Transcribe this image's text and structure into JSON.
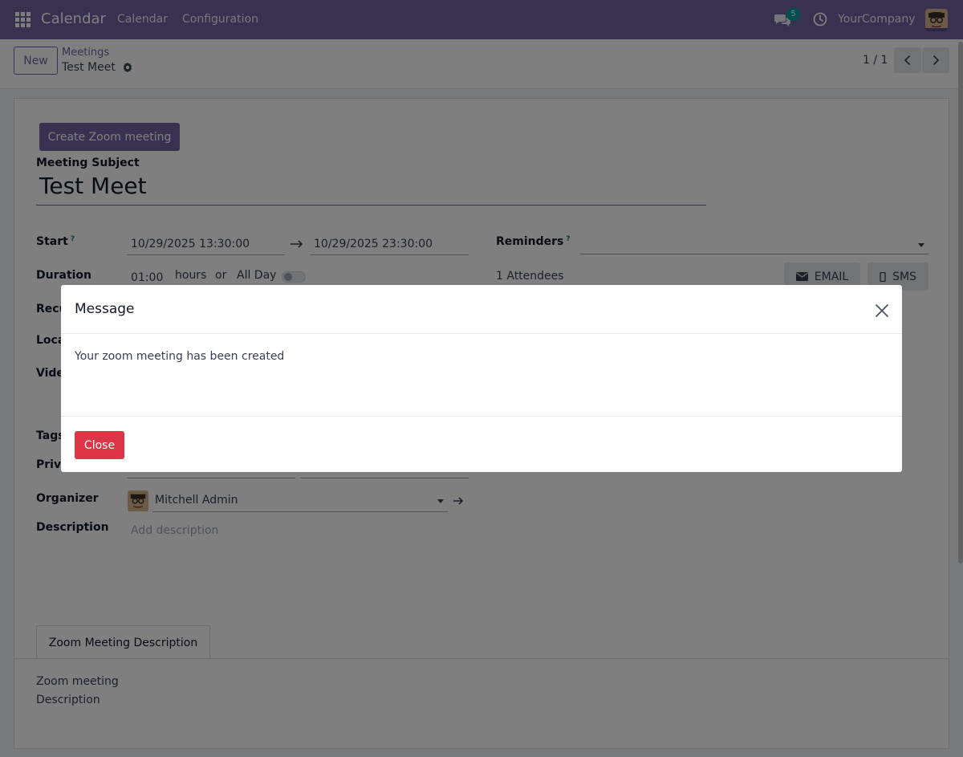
{
  "navbar": {
    "app_name": "Calendar",
    "menu": [
      "Calendar",
      "Configuration"
    ],
    "chat_count": "5",
    "company": "YourCompany"
  },
  "control_panel": {
    "new_label": "New",
    "breadcrumb_parent": "Meetings",
    "breadcrumb_current": "Test Meet",
    "pager": "1 / 1"
  },
  "form": {
    "zoom_button": "Create Zoom meeting",
    "subject_label": "Meeting Subject",
    "subject_value": "Test Meet",
    "start_label": "Start",
    "start_date": "10/29/2025 13:30:00",
    "end_date": "10/29/2025 23:30:00",
    "duration_label": "Duration",
    "duration_value": "01:00",
    "hours_text": "hours",
    "or_text": "or",
    "allday_text": "All Day",
    "reminders_label": "Reminders",
    "attendees_text": "1 Attendees",
    "email_button": "EMAIL",
    "sms_button": "SMS",
    "recurrence_label_partial": "Recu",
    "location_label_partial": "Loca",
    "video_label_partial": "Vide",
    "tags_label_partial": "Tags",
    "privacy_label_partial": "Priva",
    "organizer_label": "Organizer",
    "organizer_value": "Mitchell Admin",
    "description_label": "Description",
    "description_placeholder": "Add description",
    "tab_label": "Zoom Meeting Description",
    "tab_content": "Zoom meeting Description"
  },
  "modal": {
    "title": "Message",
    "body": "Your zoom meeting has been created",
    "close_label": "Close"
  },
  "colors": {
    "brand": "#71639e",
    "danger": "#dc3545",
    "badge": "#00a09d"
  }
}
